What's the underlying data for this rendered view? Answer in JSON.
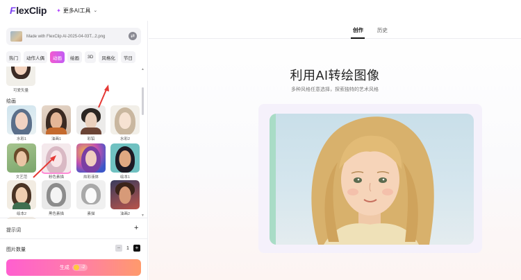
{
  "header": {
    "logo_prefix": "F",
    "logo_rest": "lexClip",
    "ai_menu_label": "更多AI工具",
    "ai_menu_icon": "sparkle-icon"
  },
  "left_panel": {
    "file_name": "Made with FlexClip AI-2025-04-03T...2.png",
    "categories": [
      {
        "label": "热门",
        "active": false
      },
      {
        "label": "动作人偶",
        "active": false
      },
      {
        "label": "动画",
        "active": true
      },
      {
        "label": "绘画",
        "active": false
      },
      {
        "label": "3D",
        "active": false
      },
      {
        "label": "风格化",
        "active": false
      },
      {
        "label": "节日",
        "active": false
      }
    ],
    "partial_tile_label": "可爱矢量",
    "section_title": "绘画",
    "styles": [
      {
        "label": "水彩1"
      },
      {
        "label": "油画1"
      },
      {
        "label": "彩铅"
      },
      {
        "label": "水彩2"
      },
      {
        "label": "文艺范"
      },
      {
        "label": "粉色素描"
      },
      {
        "label": "炫彩液体"
      },
      {
        "label": "绘本1"
      },
      {
        "label": "绘本2"
      },
      {
        "label": "黑色素描"
      },
      {
        "label": "素描"
      },
      {
        "label": "油画2"
      }
    ],
    "selected_style": "粉色素描",
    "prompt_label": "提示词",
    "prompt_action": "+",
    "count_label": "图片数量",
    "count_value": "1",
    "minus": "−",
    "plus": "+",
    "generate_label": "生成",
    "credit_cost": "-2"
  },
  "right_panel": {
    "tabs": [
      {
        "label": "创作",
        "active": true
      },
      {
        "label": "历史",
        "active": false
      }
    ],
    "title": "利用AI转绘图像",
    "subtitle": "多种风格任意选择，探索独特的艺术风格"
  },
  "colors": {
    "accent_pink": "#f25bd0",
    "accent_purple": "#c35cf5",
    "annotation_red": "#e53935"
  }
}
